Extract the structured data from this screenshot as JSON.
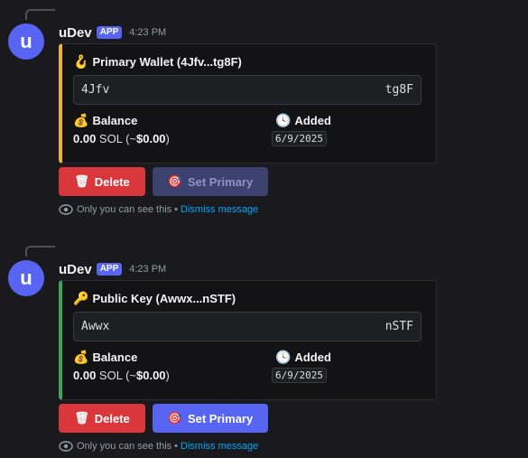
{
  "messages": [
    {
      "avatar_letter": "u",
      "username": "uDev",
      "badge": "APP",
      "time": "4:23 PM",
      "accent": "#f0b232",
      "title_emoji": "🪝",
      "title": "Primary Wallet (4Jfv...tg8F)",
      "address_start": "4Jfv",
      "address_end": "tg8F",
      "balance_emoji": "💰",
      "balance_label": "Balance",
      "balance_sol": "0.00",
      "balance_unit": " SOL (~",
      "balance_usd": "$0.00",
      "balance_close": ")",
      "added_emoji": "🕓",
      "added_label": "Added",
      "added_date": "6/9/2025",
      "delete_icon": "🗑",
      "delete_label": "Delete",
      "primary_icon": "🎯",
      "primary_label": "Set Primary",
      "primary_disabled": true,
      "only_you": "Only you can see this",
      "separator": "•",
      "dismiss": "Dismiss message"
    },
    {
      "avatar_letter": "u",
      "username": "uDev",
      "badge": "APP",
      "time": "4:23 PM",
      "accent": "#3ba55c",
      "title_emoji": "🔑",
      "title": "Public Key (Awwx...nSTF)",
      "address_start": "Awwx",
      "address_end": "nSTF",
      "balance_emoji": "💰",
      "balance_label": "Balance",
      "balance_sol": "0.00",
      "balance_unit": " SOL (~",
      "balance_usd": "$0.00",
      "balance_close": ")",
      "added_emoji": "🕓",
      "added_label": "Added",
      "added_date": "6/9/2025",
      "delete_icon": "🗑",
      "delete_label": "Delete",
      "primary_icon": "🎯",
      "primary_label": "Set Primary",
      "primary_disabled": false,
      "only_you": "Only you can see this",
      "separator": "•",
      "dismiss": "Dismiss message"
    }
  ]
}
